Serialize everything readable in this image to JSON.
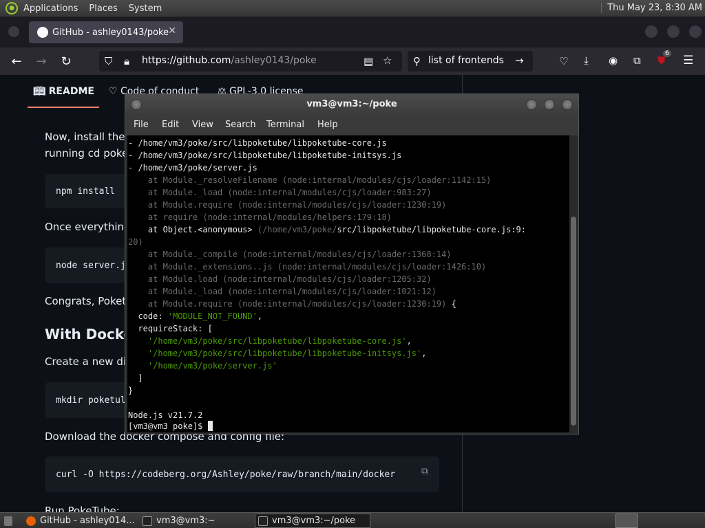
{
  "top_panel": {
    "menus": [
      "Applications",
      "Places",
      "System"
    ],
    "clock": "Thu May 23,  8:30 AM"
  },
  "browser": {
    "active_tab_title": "GitHub - ashley0143/poke",
    "url_host": "https://github.com",
    "url_path": "/ashley0143/poke",
    "search_text": "list of frontends",
    "extension_badge": "6"
  },
  "github": {
    "tabs": [
      "README",
      "Code of conduct",
      "GPL-3.0 license"
    ],
    "paragraphs": {
      "install_1": "Now, install the r",
      "install_2": "running cd poke)",
      "once": "Once everything",
      "congrats": "Congrats, Poketu",
      "create_dir": "Create a new dir",
      "download": "Download the docker compose and config file:",
      "run": "Run PokeTube:"
    },
    "heading_docker": "With Docker",
    "code": {
      "npm": "npm install",
      "node": "node server.j",
      "mkdir": "mkdir poketul",
      "curl": "curl -O https://codeberg.org/Ashley/poke/raw/branch/main/docker"
    }
  },
  "terminal": {
    "title": "vm3@vm3:~/poke",
    "menu": [
      "File",
      "Edit",
      "View",
      "Search",
      "Terminal",
      "Help"
    ],
    "lines": [
      {
        "text": "- /home/vm3/poke/src/libpoketube/libpoketube-core.js",
        "style": "normal"
      },
      {
        "text": "- /home/vm3/poke/src/libpoketube/libpoketube-initsys.js",
        "style": "normal"
      },
      {
        "text": "- /home/vm3/poke/server.js",
        "style": "normal"
      },
      {
        "text": "    at Module._resolveFilename (node:internal/modules/cjs/loader:1142:15)",
        "style": "dim"
      },
      {
        "text": "    at Module._load (node:internal/modules/cjs/loader:983:27)",
        "style": "dim"
      },
      {
        "text": "    at Module.require (node:internal/modules/cjs/loader:1230:19)",
        "style": "dim"
      },
      {
        "text": "    at require (node:internal/modules/helpers:179:18)",
        "style": "dim"
      },
      {
        "text": "    at Object.<anonymous> (/home/vm3/poke/src/libpoketube/libpoketube-core.js:9:",
        "style": "mixed_anon"
      },
      {
        "text": "20)",
        "style": "dim"
      },
      {
        "text": "    at Module._compile (node:internal/modules/cjs/loader:1368:14)",
        "style": "dim"
      },
      {
        "text": "    at Module._extensions..js (node:internal/modules/cjs/loader:1426:10)",
        "style": "dim"
      },
      {
        "text": "    at Module.load (node:internal/modules/cjs/loader:1205:32)",
        "style": "dim"
      },
      {
        "text": "    at Module._load (node:internal/modules/cjs/loader:1021:12)",
        "style": "dim"
      },
      {
        "text": "    at Module.require (node:internal/modules/cjs/loader:1230:19) {",
        "style": "mixed_brace"
      },
      {
        "text": "  code: 'MODULE_NOT_FOUND',",
        "style": "mixed_code"
      },
      {
        "text": "  requireStack: [",
        "style": "normal"
      },
      {
        "text": "    '/home/vm3/poke/src/libpoketube/libpoketube-core.js',",
        "style": "str_comma"
      },
      {
        "text": "    '/home/vm3/poke/src/libpoketube/libpoketube-initsys.js',",
        "style": "str_comma"
      },
      {
        "text": "    '/home/vm3/poke/server.js'",
        "style": "str"
      },
      {
        "text": "  ]",
        "style": "normal"
      },
      {
        "text": "}",
        "style": "normal"
      },
      {
        "text": "",
        "style": "normal"
      },
      {
        "text": "Node.js v21.7.2",
        "style": "normal"
      }
    ],
    "prompt": "[vm3@vm3 poke]$ "
  },
  "taskbar": {
    "tasks": [
      "GitHub - ashley014...",
      "vm3@vm3:~",
      "vm3@vm3:~/poke"
    ]
  }
}
